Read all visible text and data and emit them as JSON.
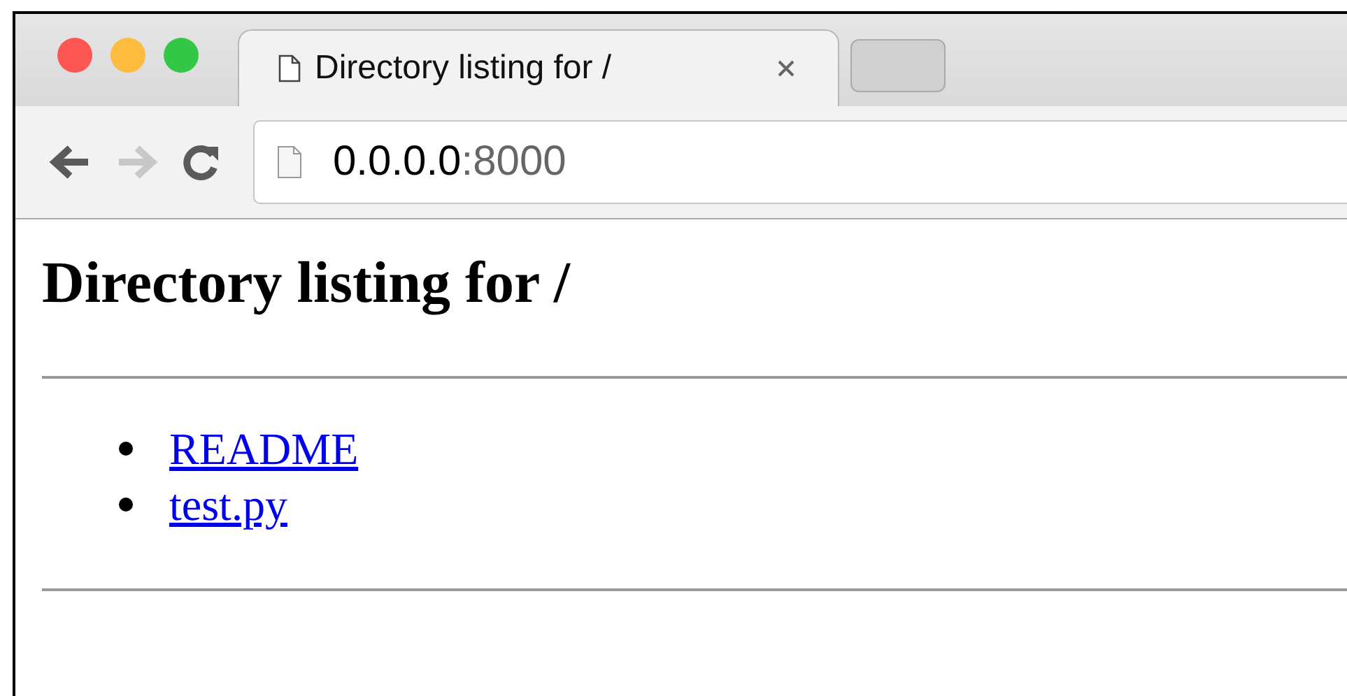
{
  "tabs": [
    {
      "title": "Directory listing for /",
      "selected": true
    }
  ],
  "toolbar": {
    "back_disabled": false,
    "forward_disabled": true
  },
  "address_bar": {
    "host": "0.0.0.0",
    "port": ":8000"
  },
  "page": {
    "heading": "Directory listing for /",
    "links": [
      {
        "text": "README"
      },
      {
        "text": "test.py"
      }
    ]
  }
}
